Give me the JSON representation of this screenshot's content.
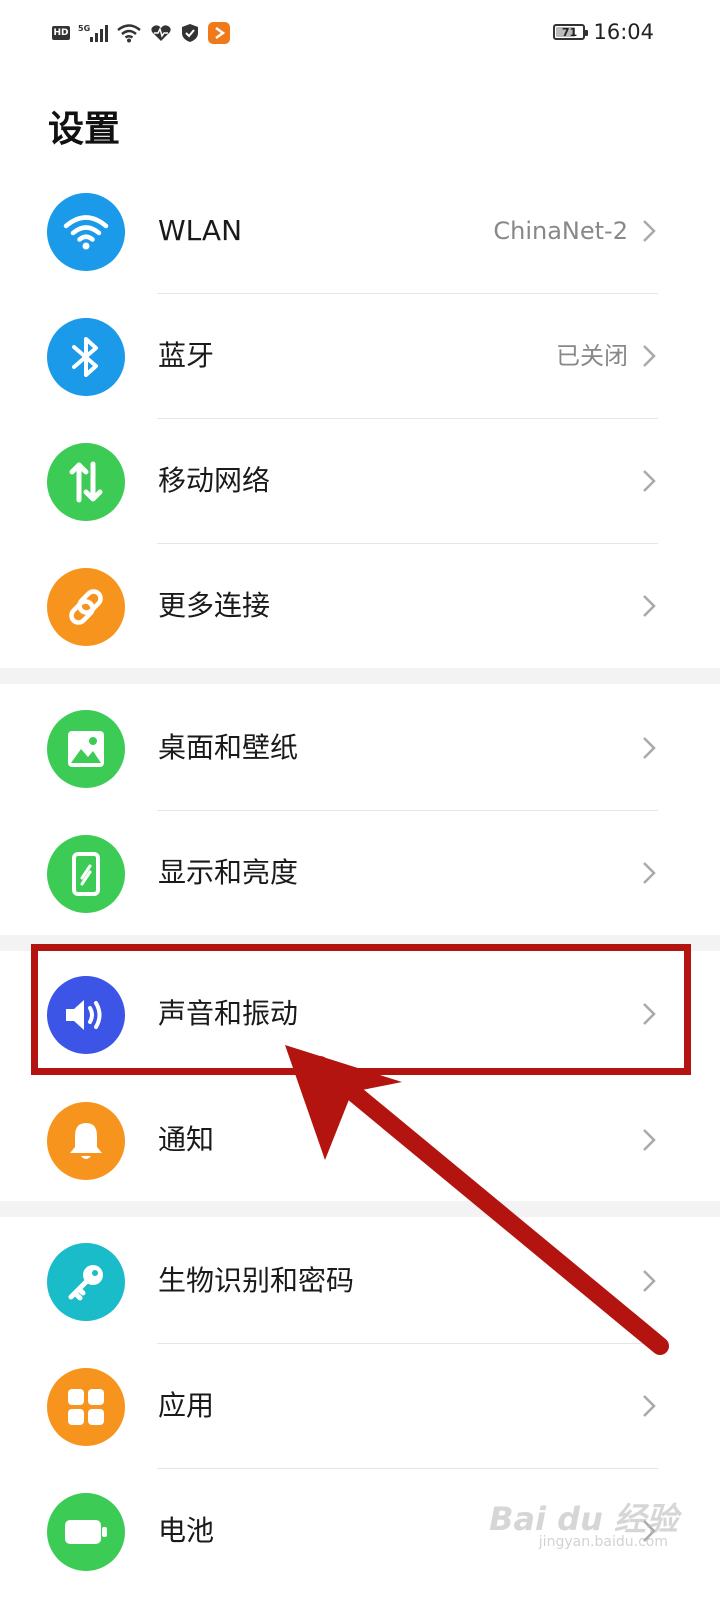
{
  "status_bar": {
    "hd_badge": "HD",
    "network": "5G",
    "battery_level": "71",
    "time": "16:04",
    "icons": [
      "hd-icon",
      "signal-icon",
      "wifi-icon",
      "heartbeat-icon",
      "shield-icon",
      "app-icon"
    ]
  },
  "page": {
    "title": "设置"
  },
  "groups": [
    {
      "items": [
        {
          "label": "WLAN",
          "value": "ChinaNet-2",
          "icon": "wifi-icon",
          "color": "#1a9ae8"
        },
        {
          "label": "蓝牙",
          "value": "已关闭",
          "icon": "bluetooth-icon",
          "color": "#1a9ae8"
        },
        {
          "label": "移动网络",
          "value": "",
          "icon": "mobile-network-icon",
          "color": "#3ccb55"
        },
        {
          "label": "更多连接",
          "value": "",
          "icon": "link-icon",
          "color": "#f7941d"
        }
      ]
    },
    {
      "items": [
        {
          "label": "桌面和壁纸",
          "value": "",
          "icon": "image-icon",
          "color": "#3ccb55"
        },
        {
          "label": "显示和亮度",
          "value": "",
          "icon": "phone-display-icon",
          "color": "#3ccb55"
        }
      ]
    },
    {
      "items": [
        {
          "label": "声音和振动",
          "value": "",
          "icon": "speaker-icon",
          "color": "#3c55e6"
        },
        {
          "label": "通知",
          "value": "",
          "icon": "bell-icon",
          "color": "#f7941d"
        }
      ]
    },
    {
      "items": [
        {
          "label": "生物识别和密码",
          "value": "",
          "icon": "key-icon",
          "color": "#1bbcc9"
        },
        {
          "label": "应用",
          "value": "",
          "icon": "apps-grid-icon",
          "color": "#f7941d"
        },
        {
          "label": "电池",
          "value": "",
          "icon": "battery-icon",
          "color": "#3ccb55"
        }
      ]
    }
  ],
  "annotation": {
    "highlight_color": "#b41410",
    "highlighted_item": "声音和振动"
  },
  "watermark": {
    "text": "Bai du 经验",
    "sub": "jingyan.baidu.com"
  }
}
